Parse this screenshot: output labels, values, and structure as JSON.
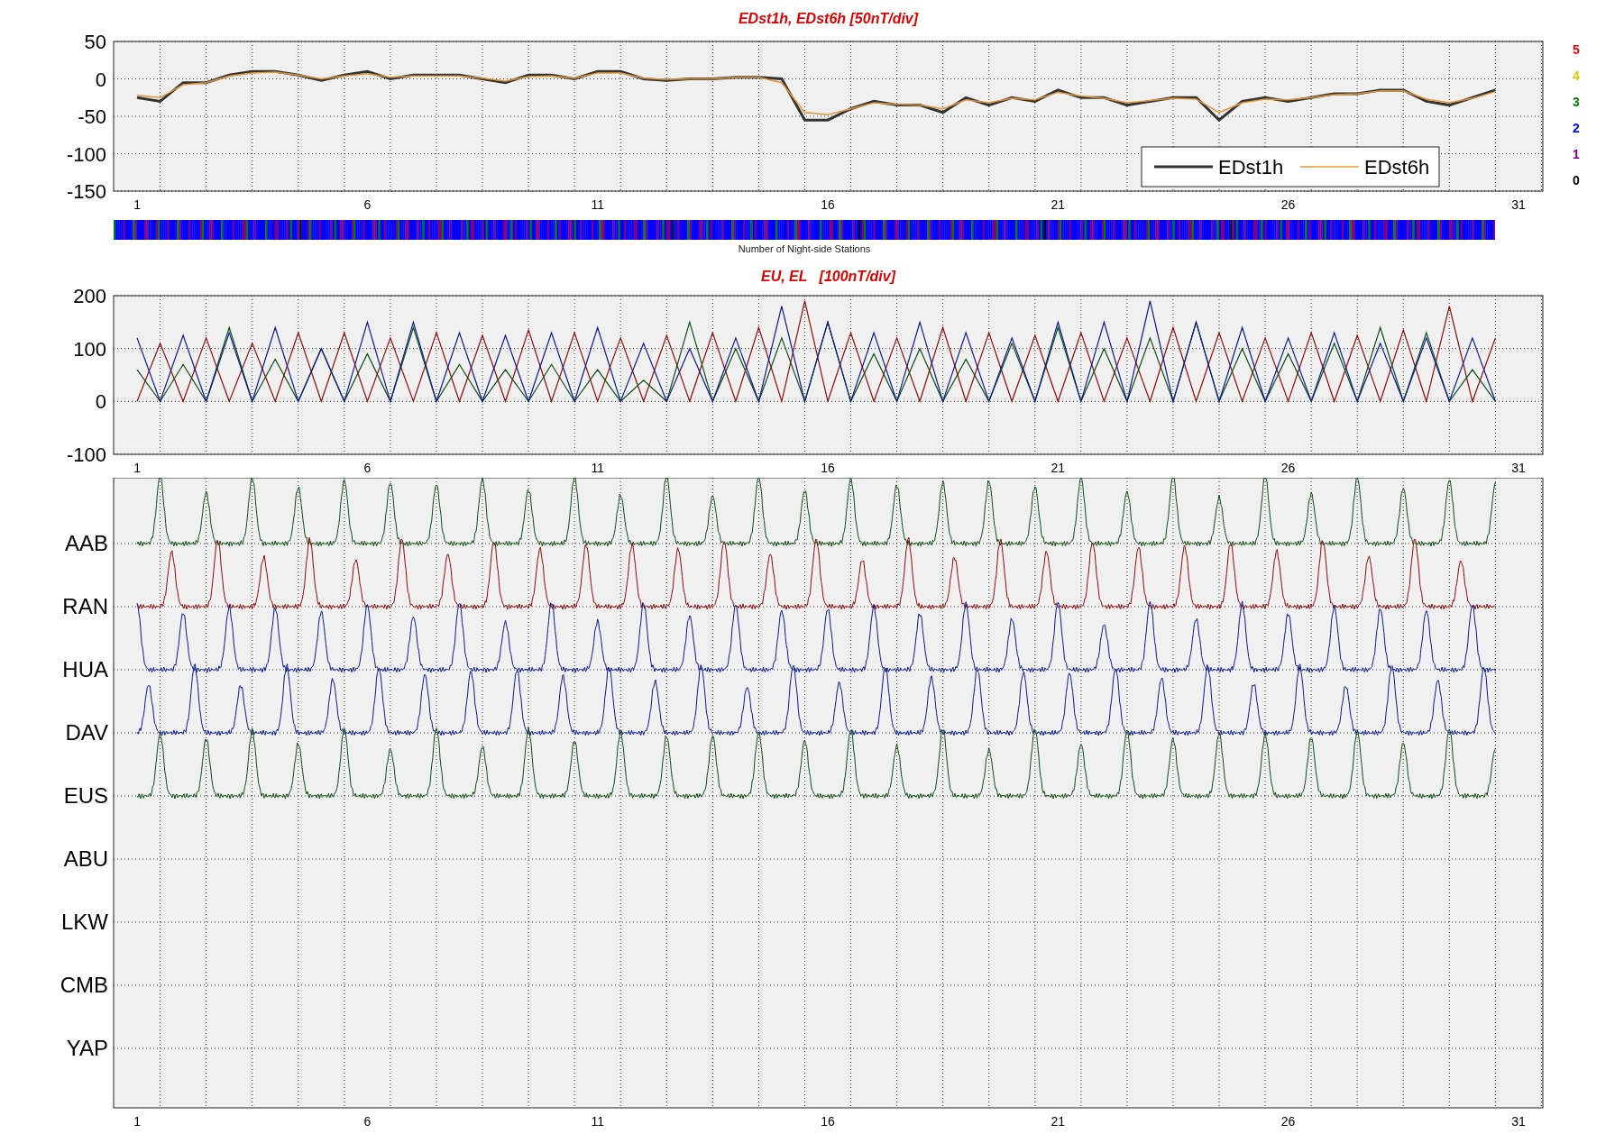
{
  "top_chart": {
    "title": "EDst1h, EDst6h [50nT/div]",
    "chart_data": {
      "type": "line",
      "x": [
        1,
        1.5,
        2,
        2.5,
        3,
        3.5,
        4,
        4.5,
        5,
        5.5,
        6,
        6.5,
        7,
        7.5,
        8,
        8.5,
        9,
        9.5,
        10,
        10.5,
        11,
        11.5,
        12,
        12.5,
        13,
        13.5,
        14,
        14.5,
        15,
        15.5,
        16,
        16.5,
        17,
        17.5,
        18,
        18.5,
        19,
        19.5,
        20,
        20.5,
        21,
        21.5,
        22,
        22.5,
        23,
        23.5,
        24,
        24.5,
        25,
        25.5,
        26,
        26.5,
        27,
        27.5,
        28,
        28.5,
        29,
        29.5,
        30,
        30.5
      ],
      "series": [
        {
          "name": "EDst1h",
          "color": "#333333",
          "values": [
            -25,
            -30,
            -5,
            -5,
            5,
            10,
            10,
            5,
            -2,
            5,
            10,
            0,
            5,
            5,
            5,
            0,
            -5,
            5,
            5,
            0,
            10,
            10,
            0,
            -2,
            0,
            0,
            2,
            2,
            0,
            -55,
            -55,
            -40,
            -30,
            -35,
            -35,
            -45,
            -25,
            -35,
            -25,
            -30,
            -15,
            -25,
            -25,
            -35,
            -30,
            -25,
            -25,
            -55,
            -30,
            -25,
            -30,
            -25,
            -20,
            -20,
            -15,
            -15,
            -30,
            -35,
            -25,
            -15
          ]
        },
        {
          "name": "EDst6h",
          "color": "#e0953a",
          "values": [
            -22,
            -25,
            -8,
            -5,
            4,
            8,
            9,
            5,
            0,
            4,
            7,
            2,
            4,
            4,
            4,
            1,
            -3,
            3,
            4,
            1,
            8,
            8,
            1,
            -1,
            0,
            0,
            2,
            2,
            -5,
            -45,
            -48,
            -40,
            -32,
            -34,
            -35,
            -40,
            -28,
            -32,
            -26,
            -28,
            -18,
            -23,
            -26,
            -32,
            -29,
            -26,
            -27,
            -45,
            -32,
            -27,
            -28,
            -25,
            -21,
            -20,
            -16,
            -16,
            -27,
            -32,
            -26,
            -17
          ]
        }
      ],
      "xlim": [
        0.49,
        31.53
      ],
      "ylim": [
        -150,
        50
      ],
      "xticks": [
        1,
        6,
        11,
        16,
        21,
        26,
        31
      ],
      "yticks": [
        50,
        0,
        -50,
        -100,
        -150
      ],
      "grid": true,
      "legend": true
    }
  },
  "station_count_legend": [
    {
      "label": "5",
      "color": "#ff0000"
    },
    {
      "label": "4",
      "color": "#d8c800"
    },
    {
      "label": "3",
      "color": "#008000"
    },
    {
      "label": "2",
      "color": "#0000ff"
    },
    {
      "label": "1",
      "color": "#800080"
    },
    {
      "label": "0",
      "color": "#000000"
    }
  ],
  "strip": {
    "caption": "Number of Night-side Stations"
  },
  "middle_chart": {
    "title": "EU, EL   [100nT/div]",
    "chart_data": {
      "type": "line",
      "x": [
        1,
        1.5,
        2,
        2.5,
        3,
        3.5,
        4,
        4.5,
        5,
        5.5,
        6,
        6.5,
        7,
        7.5,
        8,
        8.5,
        9,
        9.5,
        10,
        10.5,
        11,
        11.5,
        12,
        12.5,
        13,
        13.5,
        14,
        14.5,
        15,
        15.5,
        16,
        16.5,
        17,
        17.5,
        18,
        18.5,
        19,
        19.5,
        20,
        20.5,
        21,
        21.5,
        22,
        22.5,
        23,
        23.5,
        24,
        24.5,
        25,
        25.5,
        26,
        26.5,
        27,
        27.5,
        28,
        28.5,
        29,
        29.5,
        30,
        30.5
      ],
      "series": [
        {
          "color": "#8b0a0a",
          "values": [
            0,
            110,
            0,
            120,
            0,
            110,
            0,
            130,
            0,
            130,
            0,
            120,
            0,
            130,
            0,
            125,
            0,
            135,
            0,
            130,
            0,
            120,
            0,
            125,
            0,
            130,
            0,
            140,
            0,
            190,
            0,
            130,
            0,
            120,
            0,
            140,
            0,
            130,
            0,
            125,
            0,
            130,
            0,
            120,
            0,
            140,
            0,
            130,
            0,
            120,
            0,
            130,
            0,
            125,
            0,
            135,
            0,
            180,
            0,
            120
          ]
        },
        {
          "color": "#0d4d12",
          "values": [
            60,
            0,
            70,
            0,
            140,
            0,
            80,
            0,
            100,
            0,
            90,
            0,
            140,
            0,
            70,
            0,
            60,
            0,
            70,
            0,
            60,
            0,
            40,
            0,
            150,
            0,
            100,
            0,
            120,
            0,
            150,
            0,
            90,
            0,
            100,
            0,
            80,
            0,
            110,
            0,
            140,
            0,
            100,
            0,
            120,
            0,
            150,
            0,
            100,
            0,
            90,
            0,
            110,
            0,
            140,
            0,
            130,
            0,
            60,
            0
          ]
        },
        {
          "color": "#0a1a8c",
          "values": [
            120,
            0,
            125,
            0,
            130,
            0,
            140,
            0,
            100,
            0,
            150,
            0,
            150,
            0,
            130,
            0,
            125,
            0,
            130,
            0,
            140,
            0,
            110,
            0,
            100,
            0,
            120,
            0,
            180,
            0,
            150,
            0,
            130,
            0,
            150,
            0,
            130,
            0,
            120,
            0,
            150,
            0,
            150,
            0,
            190,
            0,
            150,
            0,
            140,
            0,
            120,
            0,
            130,
            0,
            110,
            0,
            120,
            0,
            120,
            0
          ]
        }
      ],
      "xlim": [
        0.49,
        31.53
      ],
      "ylim": [
        -100,
        200
      ],
      "xticks": [
        1,
        6,
        11,
        16,
        21,
        26,
        31
      ],
      "yticks": [
        200,
        100,
        0,
        -100
      ],
      "grid": true
    }
  },
  "bottom_chart": {
    "stations": [
      {
        "label": "AAB",
        "color": "#0d4d12"
      },
      {
        "label": "RAN",
        "color": "#8b0a0a"
      },
      {
        "label": "HUA",
        "color": "#0a1a8c"
      },
      {
        "label": "DAV",
        "color": "#0a1a8c"
      },
      {
        "label": "EUS",
        "color": "#0d4d12"
      },
      {
        "label": "ABU"
      },
      {
        "label": "LKW"
      },
      {
        "label": "CMB"
      },
      {
        "label": "YAP"
      }
    ],
    "xticks": [
      "1",
      "6",
      "11",
      "16",
      "21",
      "26",
      "31"
    ]
  }
}
